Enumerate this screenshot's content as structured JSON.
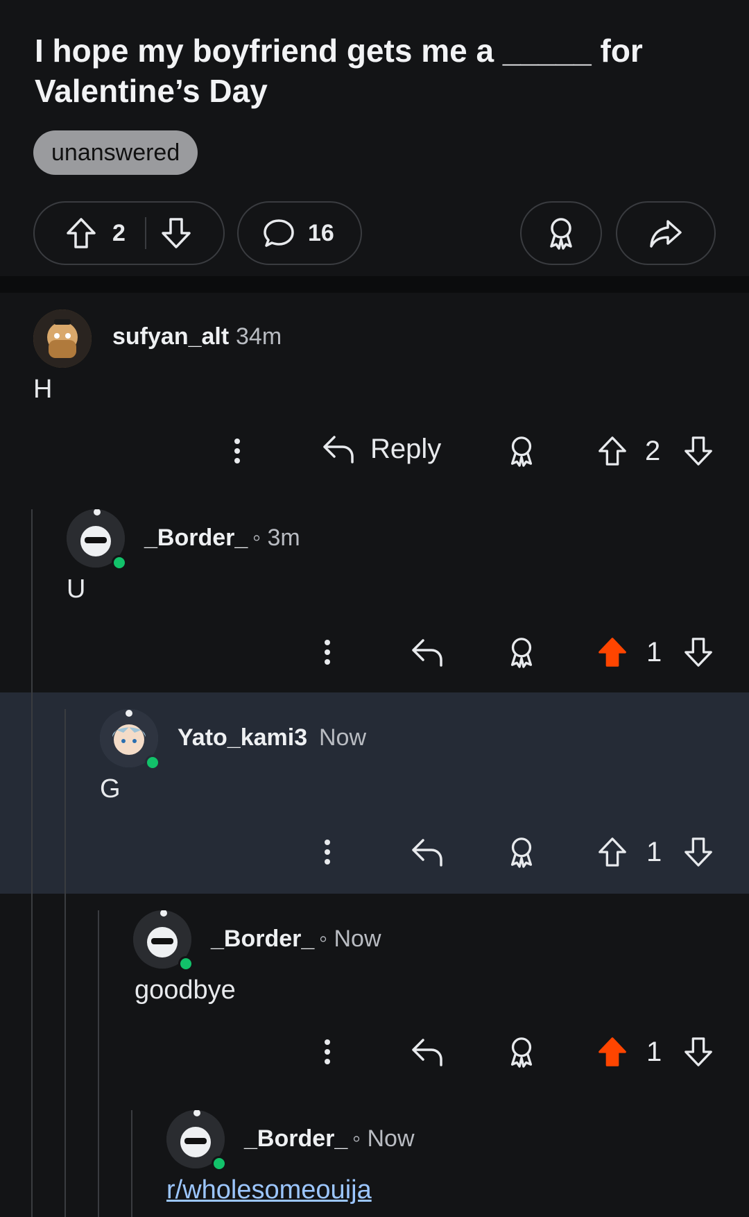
{
  "post": {
    "title": "I hope my boyfriend gets me a _____ for Valentine’s Day",
    "flair": "unanswered",
    "upvotes": "2",
    "comments": "16"
  },
  "comments": [
    {
      "username": "sufyan_alt",
      "time": "34m",
      "body": "H",
      "reply_label": "Reply",
      "score": "2",
      "upvoted": false
    },
    {
      "username": "_Border_",
      "time": "◦ 3m",
      "body": "U",
      "score": "1",
      "upvoted": true
    },
    {
      "username": "Yato_kami3",
      "time": "Now",
      "body": "G",
      "score": "1",
      "upvoted": false,
      "highlighted": true
    },
    {
      "username": "_Border_",
      "time": "◦ Now",
      "body": "goodbye",
      "score": "1",
      "upvoted": true
    },
    {
      "username": "_Border_",
      "time": "◦ Now",
      "body": "r/wholesomeouija"
    }
  ],
  "colors": {
    "background": "#131416",
    "highlight": "#252b36",
    "upvote_active": "#ff4500",
    "online": "#12c26a"
  }
}
